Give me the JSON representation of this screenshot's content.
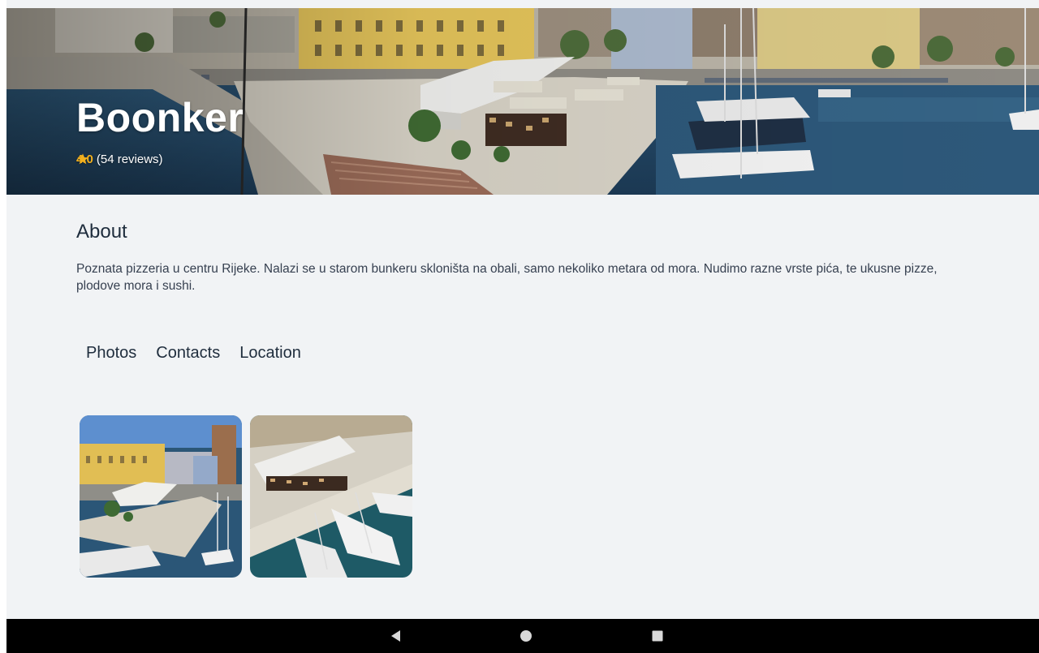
{
  "place": {
    "name": "Boonker",
    "rating": "4.0",
    "reviews": "(54 reviews)"
  },
  "about": {
    "title": "About",
    "text": "Poznata pizzeria u centru Rijeke. Nalazi se u starom bunkeru skloništa na obali, samo nekoliko metara od mora. Nudimo razne vrste pića, te ukusne pizze, plodove mora i  sushi."
  },
  "tabs": [
    {
      "label": "Photos"
    },
    {
      "label": "Contacts"
    },
    {
      "label": "Location"
    }
  ],
  "photos": [
    {
      "icon": "harbor-photo-icon"
    },
    {
      "icon": "marina-photo-icon"
    }
  ],
  "navbar": {
    "back_icon": "back-triangle-icon",
    "home_icon": "home-circle-icon",
    "recents_icon": "recents-square-icon"
  },
  "colors": {
    "background": "#f1f3f5",
    "rating_star": "#f2b01e",
    "text_dark": "#1f2d3d",
    "navbar": "#000000"
  }
}
